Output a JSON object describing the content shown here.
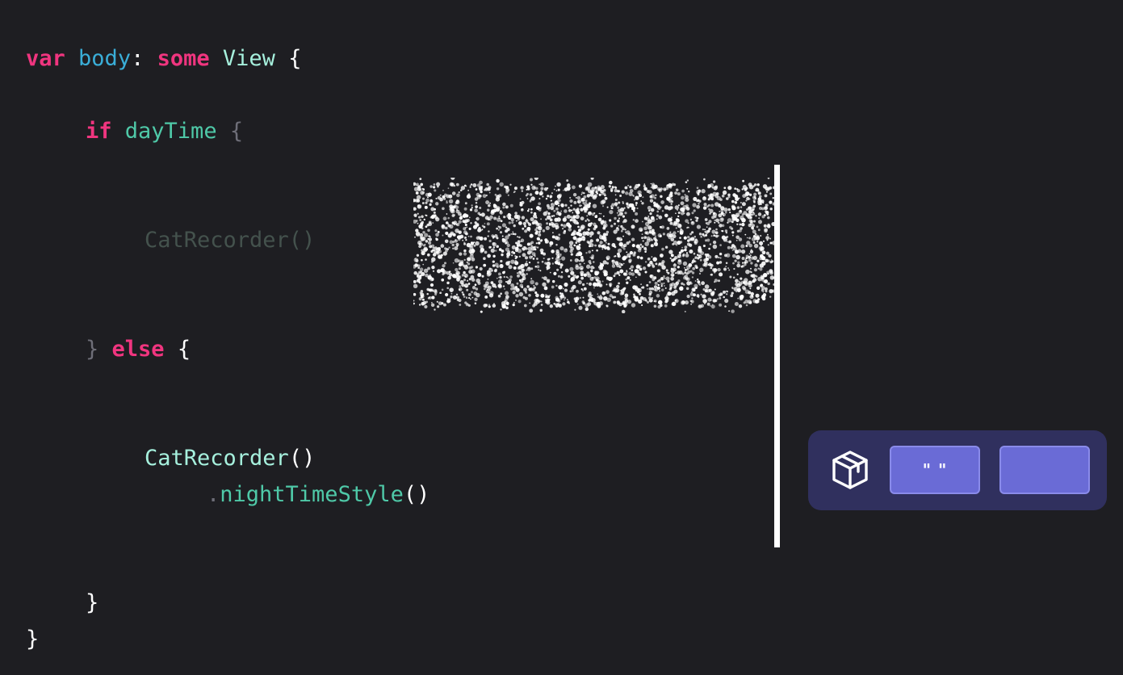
{
  "code": {
    "line1": {
      "kw1": "var",
      "name": "body",
      "colon": ":",
      "kw2": "some",
      "type": "View",
      "brace": "{"
    },
    "line2": {
      "kw": "if",
      "cond": "dayTime",
      "brace": "{"
    },
    "line3": {
      "call": "CatRecorder()"
    },
    "line4": {
      "close": "}",
      "kw": "else",
      "brace": "{"
    },
    "line5": {
      "type": "CatRecorder",
      "parens": "()"
    },
    "line6": {
      "dot": ".",
      "method": "nightTimeStyle",
      "parens": "()"
    },
    "line7": {
      "close": "}"
    },
    "line8": {
      "close": "}"
    }
  },
  "toolbar": {
    "icon": "package-icon",
    "button1_label": "\" \"",
    "button2_label": ""
  },
  "colors": {
    "background": "#1e1e22",
    "keyword": "#f0357f",
    "property": "#3aaed8",
    "type": "#a6f0dd",
    "identifier": "#4fc9a8",
    "toolbar_bg": "#30305e",
    "button": "#6a6bd6"
  }
}
